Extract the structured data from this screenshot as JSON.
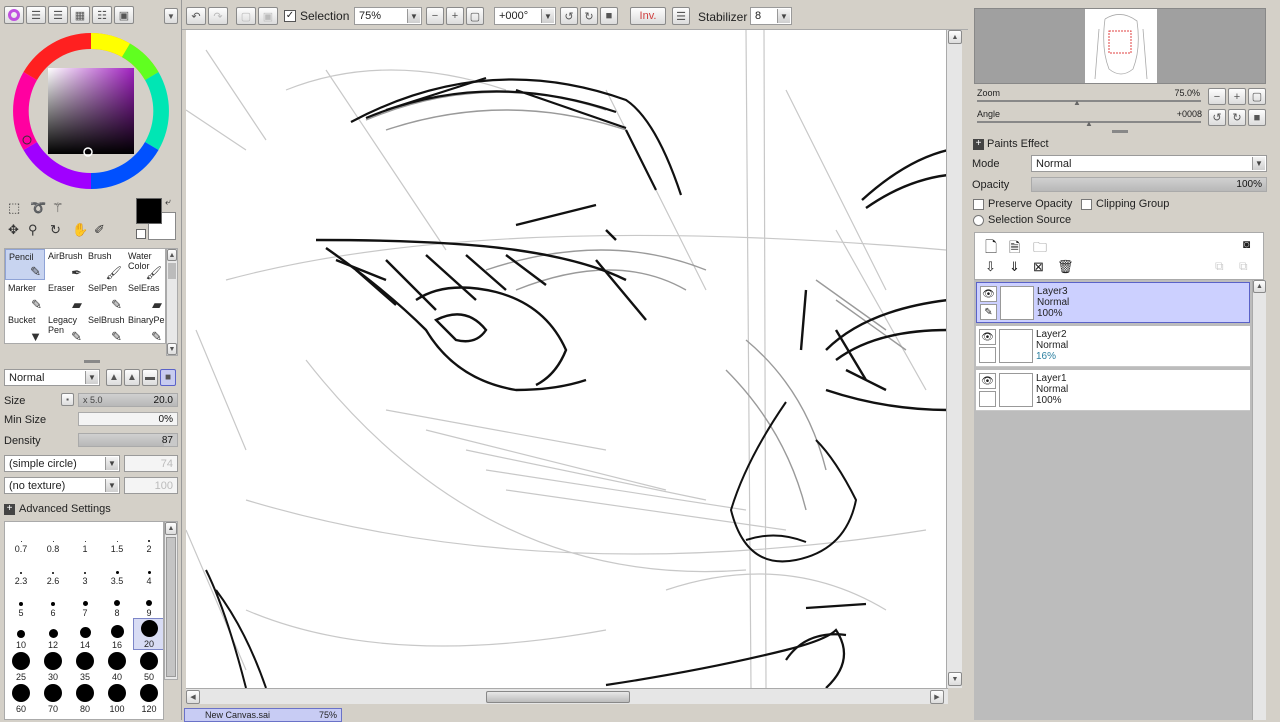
{
  "toolbar": {
    "selection_label": "Selection",
    "zoom_value": "75%",
    "rotation_value": "+000°",
    "invert_label": "Inv.",
    "stabilizer_label": "Stabilizer",
    "stabilizer_value": "8"
  },
  "tools": [
    {
      "label": "Pencil",
      "icon": "pencil-icon",
      "glyph": "✎"
    },
    {
      "label": "AirBrush",
      "icon": "airbrush-icon",
      "glyph": "✒"
    },
    {
      "label": "Brush",
      "icon": "brush-icon",
      "glyph": "🖌"
    },
    {
      "label": "Water Color",
      "icon": "watercolor-icon",
      "glyph": "🖌"
    },
    {
      "label": "Marker",
      "icon": "marker-icon",
      "glyph": "✎"
    },
    {
      "label": "Eraser",
      "icon": "eraser-icon",
      "glyph": "▰"
    },
    {
      "label": "SelPen",
      "icon": "selpen-icon",
      "glyph": "✎"
    },
    {
      "label": "SelEras",
      "icon": "seleras-icon",
      "glyph": "▰"
    },
    {
      "label": "Bucket",
      "icon": "bucket-icon",
      "glyph": "▼"
    },
    {
      "label": "Legacy Pen",
      "icon": "legacy-pen-icon",
      "glyph": "✎"
    },
    {
      "label": "SelBrush",
      "icon": "selbrush-icon",
      "glyph": "✎"
    },
    {
      "label": "BinaryPe",
      "icon": "binary-pen-icon",
      "glyph": "✎"
    }
  ],
  "brush": {
    "blend_mode": "Normal",
    "size_label": "Size",
    "size_multiplier": "x 5.0",
    "size_value": "20.0",
    "min_size_label": "Min Size",
    "min_size_value": "0%",
    "density_label": "Density",
    "density_value": "87",
    "density_fraction": 0.87,
    "shape": "(simple circle)",
    "shape_value": "74",
    "texture": "(no texture)",
    "texture_value": "100",
    "advanced_label": "Advanced Settings"
  },
  "brush_sizes": [
    {
      "label": "0.7",
      "d": 1
    },
    {
      "label": "0.8",
      "d": 1
    },
    {
      "label": "1",
      "d": 1
    },
    {
      "label": "1.5",
      "d": 1
    },
    {
      "label": "2",
      "d": 2
    },
    {
      "label": "2.3",
      "d": 2
    },
    {
      "label": "2.6",
      "d": 2
    },
    {
      "label": "3",
      "d": 2
    },
    {
      "label": "3.5",
      "d": 3
    },
    {
      "label": "4",
      "d": 3
    },
    {
      "label": "5",
      "d": 4
    },
    {
      "label": "6",
      "d": 4
    },
    {
      "label": "7",
      "d": 5
    },
    {
      "label": "8",
      "d": 6
    },
    {
      "label": "9",
      "d": 6
    },
    {
      "label": "10",
      "d": 8
    },
    {
      "label": "12",
      "d": 9
    },
    {
      "label": "14",
      "d": 11
    },
    {
      "label": "16",
      "d": 13
    },
    {
      "label": "20",
      "d": 17
    },
    {
      "label": "25",
      "d": 18
    },
    {
      "label": "30",
      "d": 18
    },
    {
      "label": "35",
      "d": 18
    },
    {
      "label": "40",
      "d": 18
    },
    {
      "label": "50",
      "d": 18
    },
    {
      "label": "60",
      "d": 18
    },
    {
      "label": "70",
      "d": 18
    },
    {
      "label": "80",
      "d": 18
    },
    {
      "label": "100",
      "d": 18
    },
    {
      "label": "120",
      "d": 18
    }
  ],
  "selected_brush_size": "20",
  "navigator": {
    "zoom_label": "Zoom",
    "zoom_value": "75.0%",
    "angle_label": "Angle",
    "angle_value": "+0008"
  },
  "layer_panel": {
    "paints_effect_label": "Paints Effect",
    "mode_label": "Mode",
    "mode_value": "Normal",
    "opacity_label": "Opacity",
    "opacity_value": "100%",
    "opacity_fraction": 1.0,
    "preserve_opacity_label": "Preserve Opacity",
    "clipping_group_label": "Clipping Group",
    "selection_source_label": "Selection Source"
  },
  "layers": [
    {
      "name": "Layer3",
      "mode": "Normal",
      "opacity": "100%",
      "selected": true
    },
    {
      "name": "Layer2",
      "mode": "Normal",
      "opacity": "16%",
      "selected": false
    },
    {
      "name": "Layer1",
      "mode": "Normal",
      "opacity": "100%",
      "selected": false
    }
  ],
  "status_tab": {
    "name": "New Canvas.sai",
    "zoom": "75%"
  },
  "colors": {
    "current_color": "#000000",
    "background": "#d4d0c8",
    "canvas": "#ffffff",
    "selection": "#ccd0ff"
  }
}
